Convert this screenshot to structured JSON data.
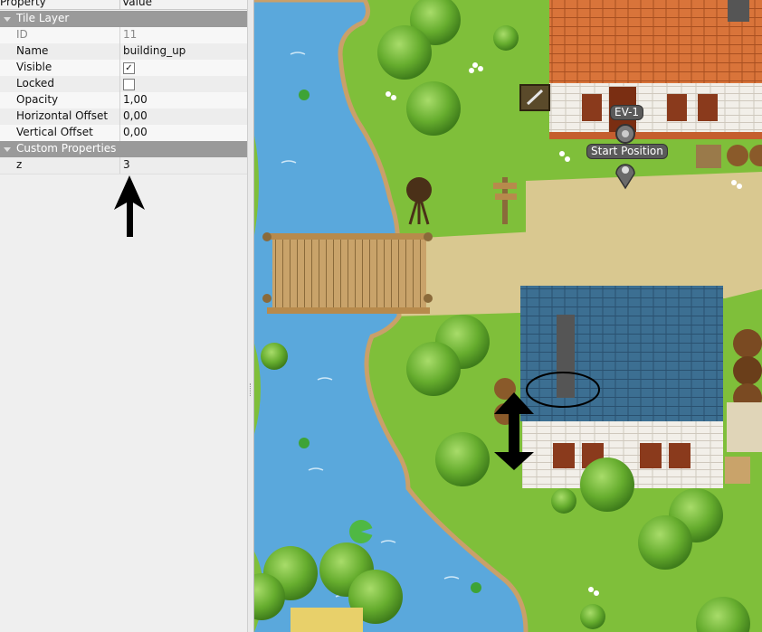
{
  "panel": {
    "header": {
      "property": "Property",
      "value": "Value"
    },
    "groups": {
      "tile_layer": "Tile Layer",
      "custom_properties": "Custom Properties"
    },
    "rows": {
      "id": {
        "label": "ID",
        "value": "11"
      },
      "name": {
        "label": "Name",
        "value": "building_up"
      },
      "visible": {
        "label": "Visible",
        "checked": true,
        "mark": "✓"
      },
      "locked": {
        "label": "Locked",
        "checked": false
      },
      "opacity": {
        "label": "Opacity",
        "value": "1,00"
      },
      "h_offset": {
        "label": "Horizontal Offset",
        "value": "0,00"
      },
      "v_offset": {
        "label": "Vertical Offset",
        "value": "0,00"
      },
      "z": {
        "label": "z",
        "value": "3"
      }
    }
  },
  "map": {
    "event_label": "EV-1",
    "start_label": "Start Position",
    "colors": {
      "grass": "#7fbf3a",
      "water": "#5aa8dc",
      "path": "#d9c890",
      "roof_orange": "#d9743a",
      "roof_blue": "#3c6f92",
      "wall": "#f4f0ea"
    }
  },
  "annotations": {
    "arrow_up": "arrow-up-icon",
    "double_arrow": "double-arrow-icon",
    "ellipse": "ellipse-highlight"
  }
}
